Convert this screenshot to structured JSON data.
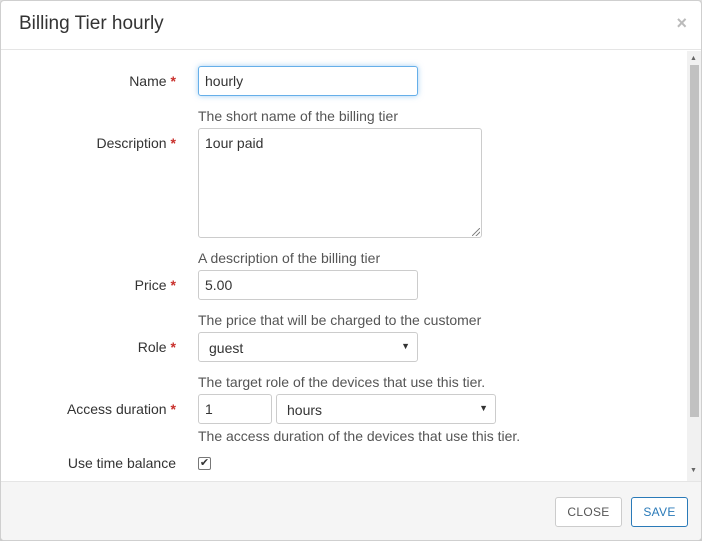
{
  "dialog": {
    "title": "Billing Tier hourly",
    "close_glyph": "×"
  },
  "form": {
    "required_marker": "*",
    "name": {
      "label": "Name",
      "value": "hourly",
      "help": "The short name of the billing tier"
    },
    "description": {
      "label": "Description",
      "value": "1our paid",
      "help": "A description of the billing tier"
    },
    "price": {
      "label": "Price",
      "value": "5.00",
      "help": "The price that will be charged to the customer"
    },
    "role": {
      "label": "Role",
      "selected": "guest",
      "help": "The target role of the devices that use this tier."
    },
    "access_duration": {
      "label": "Access duration",
      "amount": "1",
      "unit": "hours",
      "help": "The access duration of the devices that use this tier."
    },
    "use_time_balance": {
      "label": "Use time balance",
      "checked": true,
      "check_glyph": "✔"
    }
  },
  "footer": {
    "close_label": "CLOSE",
    "save_label": "SAVE"
  },
  "colors": {
    "required": "#c9302c",
    "primary": "#2a7ab8",
    "focus": "#66afe9"
  }
}
